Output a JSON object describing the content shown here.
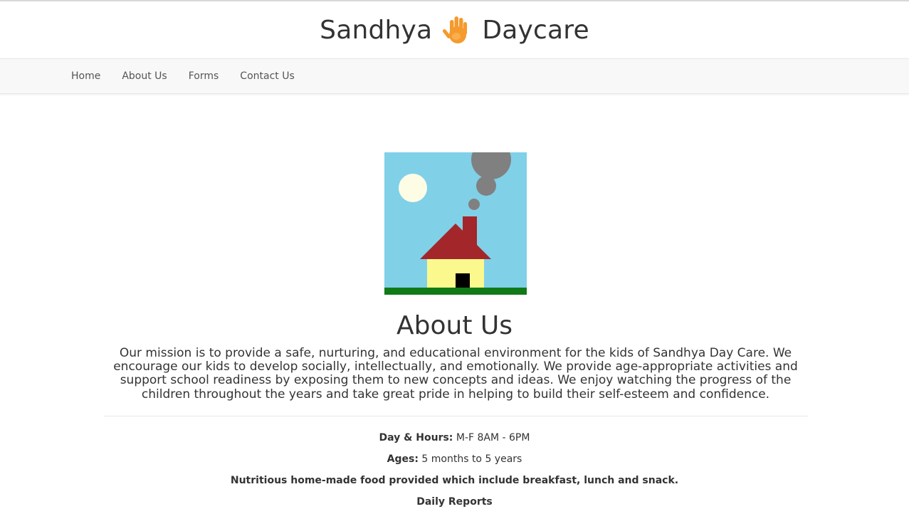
{
  "site": {
    "brand_left": "Sandhya",
    "brand_right": "Daycare",
    "brand_icon": "hand-icon",
    "accent_color": "#f59a2e"
  },
  "nav": {
    "items": [
      {
        "label": "Home"
      },
      {
        "label": "About Us"
      },
      {
        "label": "Forms"
      },
      {
        "label": "Contact Us"
      }
    ]
  },
  "hero": {
    "illustration": "house-illustration",
    "colors": {
      "sky": "#80d0e8",
      "sun": "#fdfde6",
      "smoke": "#808080",
      "roof": "#a3262a",
      "wall": "#fbf88e",
      "door": "#000000",
      "grass": "#107a16"
    }
  },
  "about": {
    "title": "About Us",
    "mission": "Our mission is to provide a safe, nurturing, and educational environment for the kids of Sandhya Day Care. We encourage our kids to develop socially, intellectually, and emotionally. We provide age-appropriate activities and support school readiness by exposing them to new concepts and ideas. We enjoy watching the progress of the children throughout the years and take great pride in helping to build their self-esteem and confidence."
  },
  "details": {
    "hours_label": "Day & Hours:",
    "hours_value": " M-F 8AM - 6PM",
    "ages_label": "Ages:",
    "ages_value": " 5 months to 5 years",
    "food": "Nutritious home-made food provided which include breakfast, lunch and snack.",
    "reports": "Daily Reports"
  }
}
